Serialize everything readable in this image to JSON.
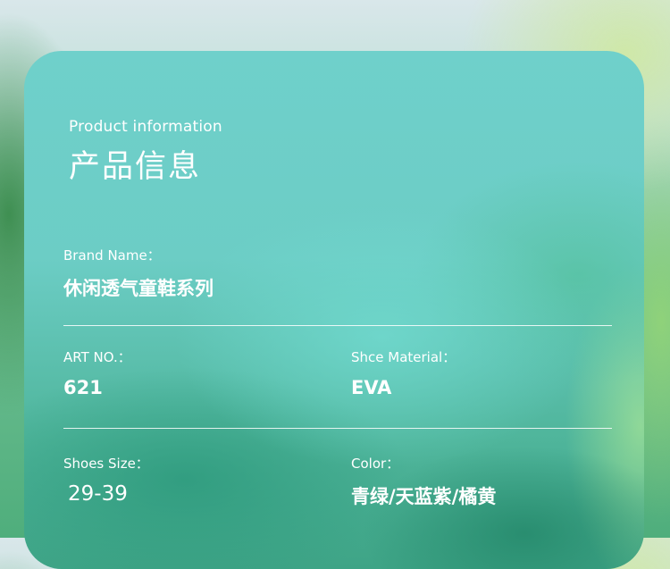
{
  "header": {
    "subtitle_en": "Product information",
    "title_cn": "产品信息"
  },
  "fields": {
    "brand_name": {
      "label": "Brand Name：",
      "value": "休闲透气童鞋系列"
    },
    "art_no": {
      "label": "ART NO.：",
      "value": "621"
    },
    "material": {
      "label": "Shce Material：",
      "value": "EVA"
    },
    "size": {
      "label": "Shoes Size：",
      "value": "29-39"
    },
    "color": {
      "label": "Color：",
      "value": "青绿/天蓝紫/橘黄"
    }
  },
  "colors": {
    "text": "#ffffff",
    "card": "#6ccdc5",
    "divider": "#ffffff"
  }
}
